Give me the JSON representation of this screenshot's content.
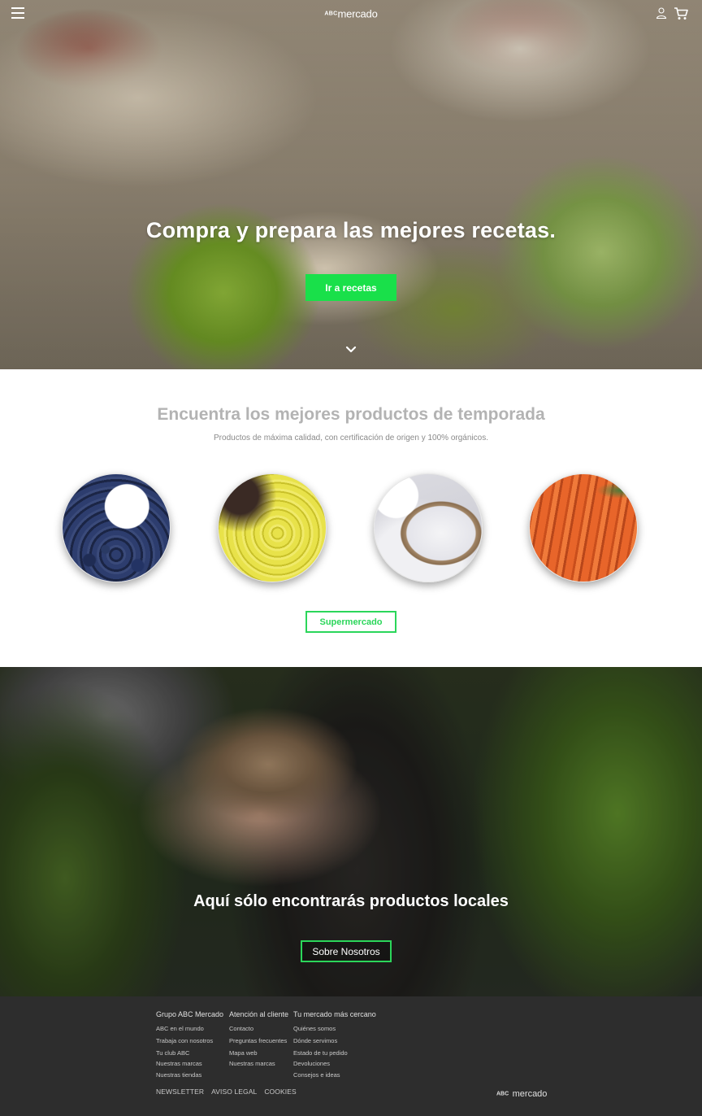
{
  "header": {
    "logo_prefix": "ABC",
    "logo_name": "mercado",
    "icons": [
      "menu-icon",
      "user-icon",
      "cart-icon"
    ]
  },
  "hero": {
    "title": "Compra y prepara las mejores recetas.",
    "button_label": "Ir a recetas",
    "scroll_icon": "chevron-down-icon"
  },
  "products": {
    "title": "Encuentra los mejores productos de temporada",
    "subtitle": "Productos de máxima calidad, con certificación de origen y 100% orgánicos.",
    "button_label": "Supermercado"
  },
  "local": {
    "title": "Aquí sólo encontrarás productos locales",
    "button_label": "Sobre Nosotros"
  },
  "footer": {
    "columns": [
      {
        "heading": "Grupo ABC Mercado",
        "links": [
          "ABC en el mundo",
          "Trabaja con nosotros",
          "Tu club ABC",
          "Nuestras marcas",
          "Nuestras tiendas"
        ]
      },
      {
        "heading": "Atención al cliente",
        "links": [
          "Contacto",
          "Preguntas frecuentes",
          "Mapa web",
          "Nuestras marcas"
        ]
      },
      {
        "heading": "Tu mercado más cercano",
        "links": [
          "Quiénes somos",
          "Dónde servimos",
          "Estado de tu pedido",
          "Devoluciones",
          "Consejos e ideas"
        ]
      }
    ],
    "bottom_links": [
      "NEWSLETTER",
      "AVISO LEGAL",
      "COOKIES"
    ],
    "logo_prefix": "ABC",
    "logo_name": "mercado"
  },
  "colors": {
    "accent_green": "#19e04a",
    "footer_bg": "#2d2d2d"
  }
}
